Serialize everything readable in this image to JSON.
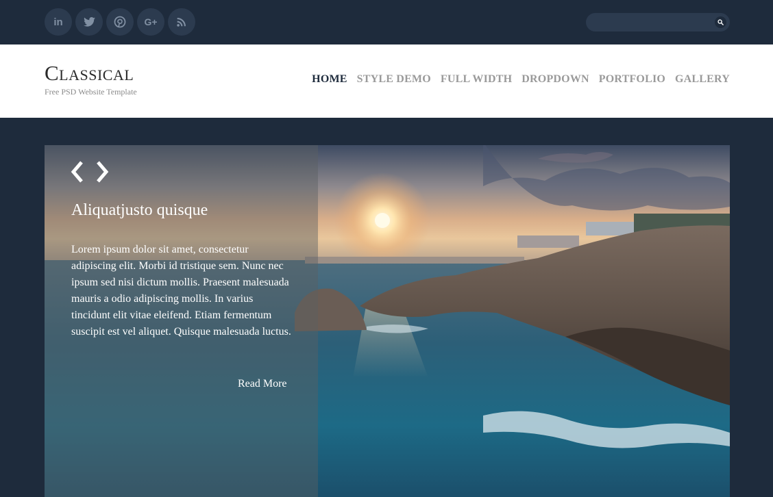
{
  "social": [
    {
      "icon": "linkedin-icon",
      "glyph": "in"
    },
    {
      "icon": "twitter-icon"
    },
    {
      "icon": "pinterest-icon"
    },
    {
      "icon": "google-plus-icon",
      "glyph": "G+"
    },
    {
      "icon": "rss-icon"
    }
  ],
  "search": {
    "placeholder": "",
    "value": ""
  },
  "site": {
    "title": "Classical",
    "tagline": "Free PSD Website Template"
  },
  "nav": [
    {
      "label": "HOME",
      "active": true
    },
    {
      "label": "STYLE DEMO",
      "active": false
    },
    {
      "label": "FULL WIDTH",
      "active": false
    },
    {
      "label": "DROPDOWN",
      "active": false
    },
    {
      "label": "PORTFOLIO",
      "active": false
    },
    {
      "label": "GALLERY",
      "active": false
    }
  ],
  "slide": {
    "title": "Aliquatjusto quisque",
    "body": "Lorem ipsum dolor sit amet, consectetur adipiscing elit. Morbi id tristique sem. Nunc nec ipsum sed nisi dictum mollis. Praesent malesuada mauris a odio adipiscing mollis. In varius tincidunt elit vitae eleifend. Etiam fermentum suscipit est vel aliquet. Quisque malesuada luctus.",
    "read_more": "Read More",
    "prev_icon": "chevron-left-icon",
    "next_icon": "chevron-right-icon"
  },
  "colors": {
    "background": "#1e2b3c",
    "social_button": "#2c3b4f",
    "nav_active": "#1e2b3c",
    "nav_inactive": "#9a9a9a"
  }
}
